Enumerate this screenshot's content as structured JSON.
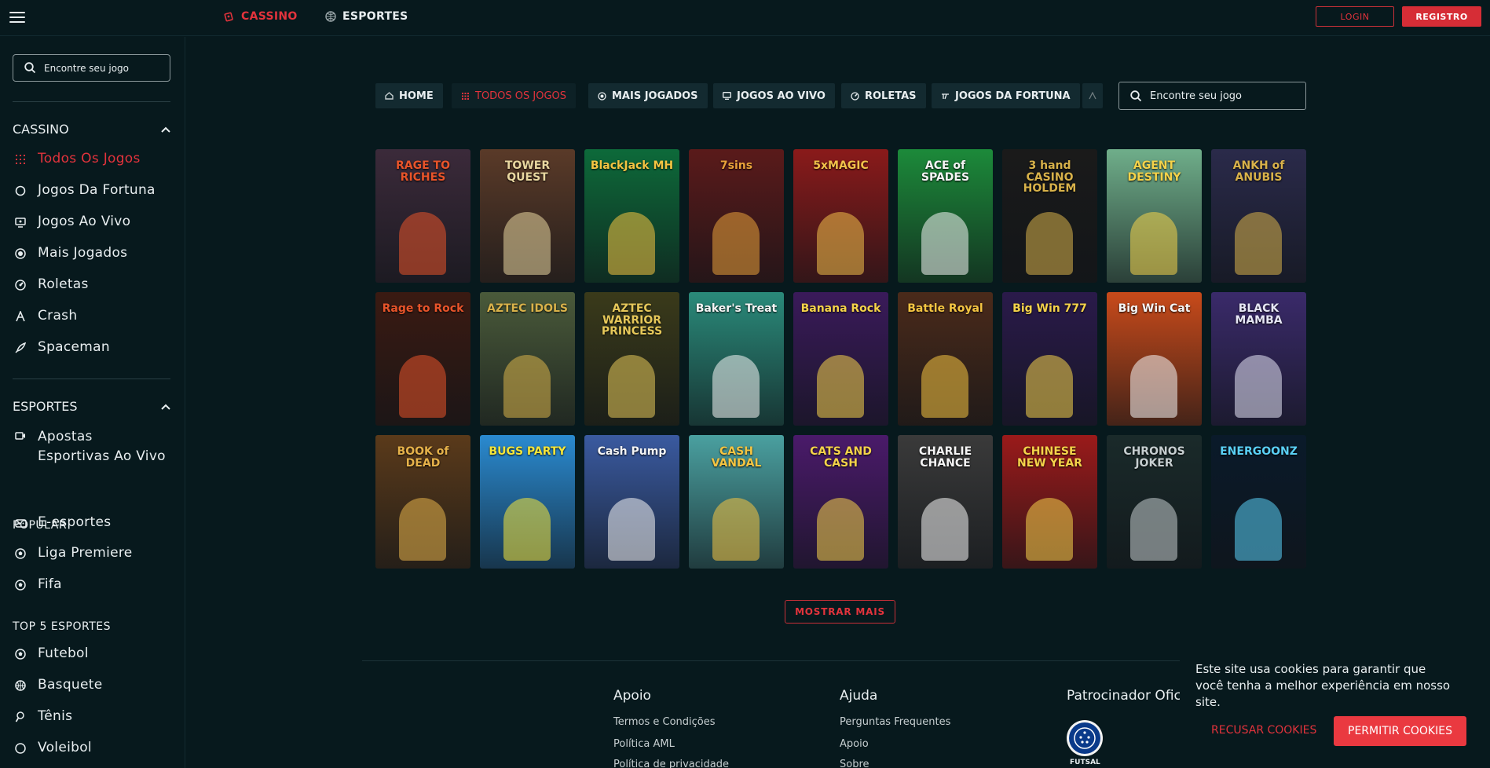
{
  "topbar": {
    "menu_icon": "hamburger-icon",
    "cassino_label": "CASSINO",
    "esportes_label": "ESPORTES",
    "login_label": "LOGIN",
    "register_label": "REGISTRO"
  },
  "sidebar": {
    "search_placeholder": "Encontre seu jogo",
    "cassino_header": "CASSINO",
    "cassino_items": [
      {
        "label": "Todos Os Jogos",
        "icon": "grid-icon"
      },
      {
        "label": "Jogos Da Fortuna",
        "icon": "circle-icon"
      },
      {
        "label": "Jogos Ao Vivo",
        "icon": "live-tv-icon"
      },
      {
        "label": "Mais Jogados",
        "icon": "target-icon"
      },
      {
        "label": "Roletas",
        "icon": "roulette-icon"
      },
      {
        "label": "Crash",
        "icon": "crash-icon"
      },
      {
        "label": "Spaceman",
        "icon": "rocket-icon"
      }
    ],
    "esportes_header": "ESPORTES",
    "esportes_items": [
      {
        "label_line1": "Apostas",
        "label_line2": "Esportivas Ao Vivo",
        "icon": "live-bet-icon"
      },
      {
        "label": "E-esportes",
        "icon": "gamepad-icon"
      }
    ],
    "popular_header": "POPULAR",
    "popular_items": [
      {
        "label": "Liga Premiere",
        "icon": "soccer-ball-icon"
      },
      {
        "label": "Fifa",
        "icon": "soccer-ball-icon"
      }
    ],
    "top5_header": "TOP 5 ESPORTES",
    "top5_items": [
      {
        "label": "Futebol",
        "icon": "soccer-ball-icon"
      },
      {
        "label": "Basquete",
        "icon": "basketball-icon"
      },
      {
        "label": "Tênis",
        "icon": "tennis-icon"
      },
      {
        "label": "Voleibol",
        "icon": "volleyball-icon"
      }
    ]
  },
  "categories": [
    {
      "label": "HOME",
      "icon": "home-icon"
    },
    {
      "label": "TODOS OS JOGOS",
      "icon": "grid-icon",
      "active": true
    },
    {
      "label": "MAIS JOGADOS",
      "icon": "target-icon"
    },
    {
      "label": "JOGOS AO VIVO",
      "icon": "live-tv-icon"
    },
    {
      "label": "ROLETAS",
      "icon": "roulette-icon"
    },
    {
      "label": "JOGOS DA FORTUNA",
      "icon": "fortune-icon"
    }
  ],
  "main_search_placeholder": "Encontre seu jogo",
  "games": [
    {
      "title": "RAGE TO RICHES",
      "bg": "#3b2a3a",
      "fg": "#e8542a"
    },
    {
      "title": "TOWER QUEST",
      "bg": "#5a3a28",
      "fg": "#e9d7a0"
    },
    {
      "title": "BlackJack MH",
      "bg": "#0d6a3a",
      "fg": "#f5c542"
    },
    {
      "title": "7sins",
      "bg": "#5a1a1a",
      "fg": "#e9a23a"
    },
    {
      "title": "5xMAGIC",
      "bg": "#8a1a1a",
      "fg": "#f2c14a"
    },
    {
      "title": "ACE of SPADES",
      "bg": "#1c8a3a",
      "fg": "#f5f5f5"
    },
    {
      "title": "3 hand CASINO HOLDEM",
      "bg": "#1a1a1a",
      "fg": "#d8b24a"
    },
    {
      "title": "AGENT DESTINY",
      "bg": "#6fae8a",
      "fg": "#f5d34a"
    },
    {
      "title": "ANKH of ANUBIS",
      "bg": "#2a2a4a",
      "fg": "#d9b24a"
    },
    {
      "title": "Rage to Rock",
      "bg": "#3a1a12",
      "fg": "#e8542a"
    },
    {
      "title": "AZTEC IDOLS",
      "bg": "#4a5a3a",
      "fg": "#d9b24a"
    },
    {
      "title": "AZTEC WARRIOR PRINCESS",
      "bg": "#3a3a1a",
      "fg": "#e6c85a"
    },
    {
      "title": "Baker's Treat",
      "bg": "#2a8a7a",
      "fg": "#f5f5f5"
    },
    {
      "title": "Banana Rock",
      "bg": "#3a1a5a",
      "fg": "#f5d34a"
    },
    {
      "title": "Battle Royal",
      "bg": "#4a2a1a",
      "fg": "#f5c542"
    },
    {
      "title": "Big Win 777",
      "bg": "#2a1a4a",
      "fg": "#f5d34a"
    },
    {
      "title": "Big Win Cat",
      "bg": "#c84a1a",
      "fg": "#f5f5f5"
    },
    {
      "title": "BLACK MAMBA",
      "bg": "#3a2a6a",
      "fg": "#e6e6f5"
    },
    {
      "title": "BOOK of DEAD",
      "bg": "#5a3a1a",
      "fg": "#e6b24a"
    },
    {
      "title": "BUGS PARTY",
      "bg": "#2a8ad0",
      "fg": "#f5e63a"
    },
    {
      "title": "Cash Pump",
      "bg": "#3a5aa0",
      "fg": "#f5f5f5"
    },
    {
      "title": "CASH VANDAL",
      "bg": "#4aa0a0",
      "fg": "#f5c542"
    },
    {
      "title": "CATS AND CASH",
      "bg": "#4a1a6a",
      "fg": "#f5d34a"
    },
    {
      "title": "CHARLIE CHANCE",
      "bg": "#3a3a3a",
      "fg": "#f5f5f5"
    },
    {
      "title": "CHINESE NEW YEAR",
      "bg": "#9a1a1a",
      "fg": "#f5d34a"
    },
    {
      "title": "CHRONOS JOKER",
      "bg": "#1a2a2a",
      "fg": "#c6ced0"
    },
    {
      "title": "ENERGOONZ",
      "bg": "#0a1a2a",
      "fg": "#5ad0f5"
    }
  ],
  "show_more_label": "MOSTRAR MAIS",
  "footer": {
    "col1_title": "Apoio",
    "col1_links": [
      "Termos e Condições",
      "Política AML",
      "Política de privacidade"
    ],
    "col2_title": "Ajuda",
    "col2_links": [
      "Perguntas Frequentes",
      "Apoio",
      "Sobre"
    ],
    "col3_title": "Patrocinador Oficial",
    "sponsor_caption": "FUTSAL"
  },
  "cookie": {
    "message": "Este site usa cookies para garantir que você tenha a melhor experiência em nosso site.",
    "reject_label": "RECUSAR COOKIES",
    "accept_label": "PERMITIR COOKIES"
  },
  "colors": {
    "accent": "#e2333c",
    "background": "#07191d",
    "panel": "#132a30"
  }
}
